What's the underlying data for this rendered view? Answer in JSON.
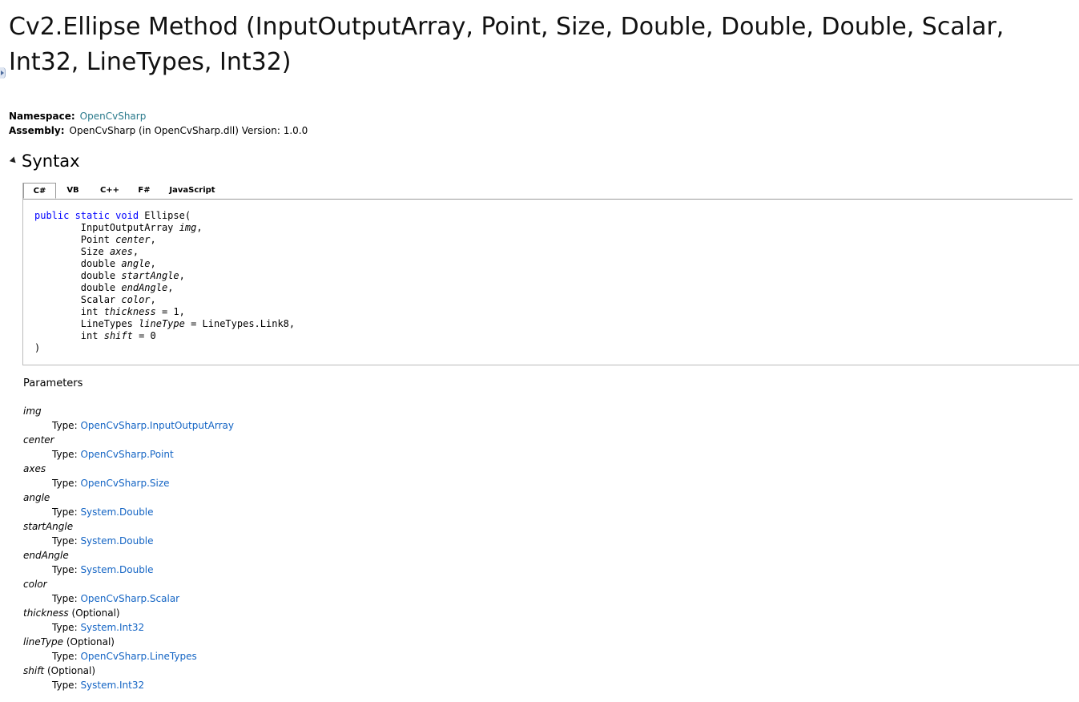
{
  "title": "Cv2.Ellipse Method (InputOutputArray, Point, Size, Double, Double, Double, Scalar, Int32, LineTypes, Int32)",
  "meta": {
    "namespace_label": "Namespace:",
    "namespace_value": "OpenCvSharp",
    "assembly_label": "Assembly:",
    "assembly_value": "OpenCvSharp (in OpenCvSharp.dll) Version: 1.0.0"
  },
  "syntax": {
    "title": "Syntax",
    "tabs": [
      "C#",
      "VB",
      "C++",
      "F#",
      "JavaScript"
    ],
    "active_tab": "C#",
    "code": {
      "kw": "public static void",
      "name": "Ellipse(",
      "params": [
        {
          "type": "InputOutputArray",
          "name": "img",
          "suffix": ","
        },
        {
          "type": "Point",
          "name": "center",
          "suffix": ","
        },
        {
          "type": "Size",
          "name": "axes",
          "suffix": ","
        },
        {
          "type": "double",
          "name": "angle",
          "suffix": ","
        },
        {
          "type": "double",
          "name": "startAngle",
          "suffix": ","
        },
        {
          "type": "double",
          "name": "endAngle",
          "suffix": ","
        },
        {
          "type": "Scalar",
          "name": "color",
          "suffix": ","
        },
        {
          "type": "int",
          "name": "thickness",
          "suffix": " = 1,"
        },
        {
          "type": "LineTypes",
          "name": "lineType",
          "suffix": " = LineTypes.Link8,"
        },
        {
          "type": "int",
          "name": "shift",
          "suffix": " = 0"
        }
      ],
      "close": ")"
    }
  },
  "parameters": {
    "heading": "Parameters",
    "type_prefix": "Type:",
    "optional_label": "(Optional)",
    "items": [
      {
        "name": "img",
        "type": "OpenCvSharp.InputOutputArray",
        "optional": false
      },
      {
        "name": "center",
        "type": "OpenCvSharp.Point",
        "optional": false
      },
      {
        "name": "axes",
        "type": "OpenCvSharp.Size",
        "optional": false
      },
      {
        "name": "angle",
        "type": "System.Double",
        "optional": false
      },
      {
        "name": "startAngle",
        "type": "System.Double",
        "optional": false
      },
      {
        "name": "endAngle",
        "type": "System.Double",
        "optional": false
      },
      {
        "name": "color",
        "type": "OpenCvSharp.Scalar",
        "optional": false
      },
      {
        "name": "thickness",
        "type": "System.Int32",
        "optional": true
      },
      {
        "name": "lineType",
        "type": "OpenCvSharp.LineTypes",
        "optional": true
      },
      {
        "name": "shift",
        "type": "System.Int32",
        "optional": true
      }
    ]
  }
}
